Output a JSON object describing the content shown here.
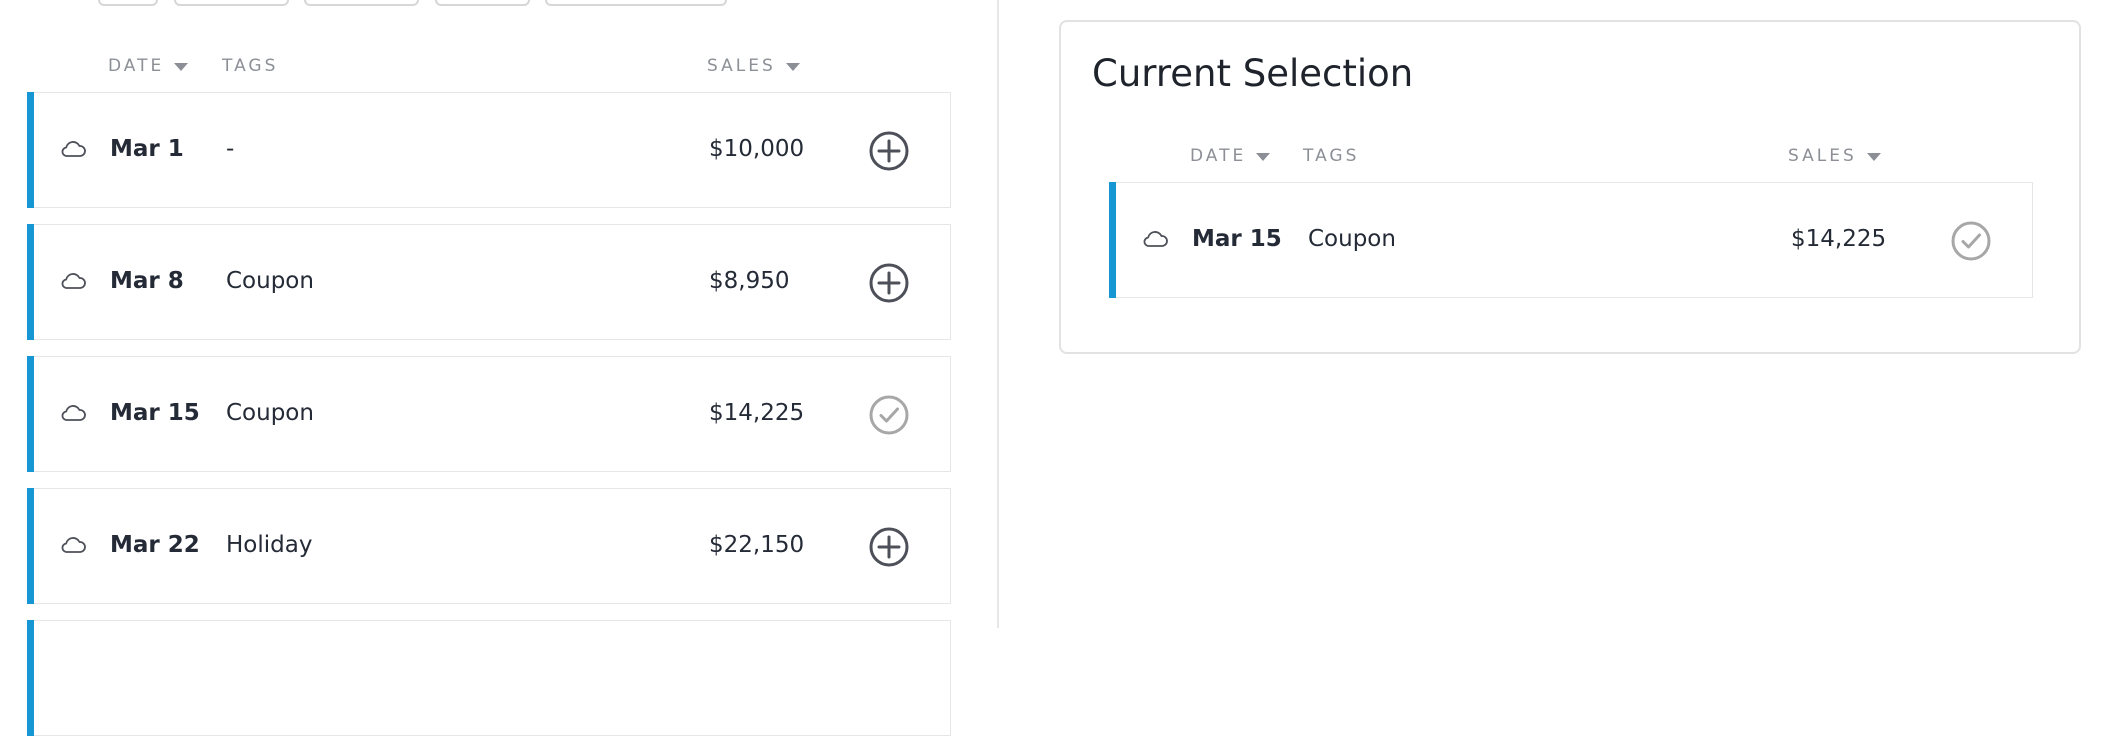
{
  "colors": {
    "accent": "#1796d4",
    "text": "#242a36",
    "muted": "#8c8f96",
    "add_icon": "#4d5058",
    "selected_icon": "#a7a7a7"
  },
  "left_table": {
    "headers": {
      "date": "DATE",
      "tags": "TAGS",
      "sales": "SALES"
    },
    "rows": [
      {
        "date": "Mar 1",
        "tag": "-",
        "sales": "$10,000",
        "icon": "cloud-icon",
        "action": "add-circle-icon"
      },
      {
        "date": "Mar 8",
        "tag": "Coupon",
        "sales": "$8,950",
        "icon": "cloud-icon",
        "action": "add-circle-icon"
      },
      {
        "date": "Mar 15",
        "tag": "Coupon",
        "sales": "$14,225",
        "icon": "cloud-icon",
        "action": "check-circle-icon"
      },
      {
        "date": "Mar 22",
        "tag": "Holiday",
        "sales": "$22,150",
        "icon": "cloud-icon",
        "action": "add-circle-icon"
      }
    ]
  },
  "selection_panel": {
    "title": "Current Selection",
    "headers": {
      "date": "DATE",
      "tags": "TAGS",
      "sales": "SALES"
    },
    "rows": [
      {
        "date": "Mar 15",
        "tag": "Coupon",
        "sales": "$14,225",
        "icon": "cloud-icon",
        "action": "check-circle-icon"
      }
    ]
  }
}
